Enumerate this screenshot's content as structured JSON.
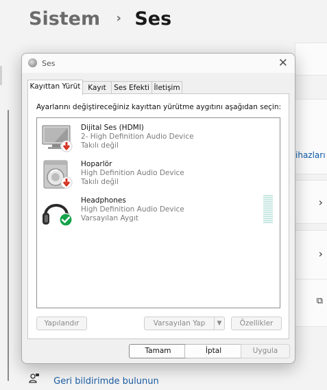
{
  "settings": {
    "breadcrumb_parent": "Sistem",
    "breadcrumb_sep": "›",
    "breadcrumb_current": "Ses",
    "link_partial": "ihazları",
    "chevron": "›",
    "external_icon": "⧉",
    "feedback_icon": "👤",
    "feedback_label": "Geri bildirimde bulunun"
  },
  "dialog": {
    "title": "Ses",
    "close_glyph": "✕",
    "tabs": [
      {
        "label": "Kayıttan Yürüt"
      },
      {
        "label": "Kayıt"
      },
      {
        "label": "Ses Efekti"
      },
      {
        "label": "İletişim"
      }
    ],
    "instruction": "Ayarlarını değiştireceğiniz kayıttan yürütme aygıtını aşağıdan seçin:",
    "devices": [
      {
        "name": "Dijital Ses (HDMI)",
        "driver": "2- High Definition Audio Device",
        "status": "Takılı değil",
        "icon": "monitor-icon",
        "badge": "red-down-arrow"
      },
      {
        "name": "Hoparlör",
        "driver": "High Definition Audio Device",
        "status": "Takılı değil",
        "icon": "speaker-icon",
        "badge": "red-down-arrow"
      },
      {
        "name": "Headphones",
        "driver": "High Definition Audio Device",
        "status": "Varsayılan Aygıt",
        "icon": "headphones-icon",
        "badge": "green-check"
      }
    ],
    "buttons": {
      "configure": "Yapılandır",
      "set_default": "Varsayılan Yap",
      "set_default_arrow": "▼",
      "properties": "Özellikler",
      "ok": "Tamam",
      "cancel": "İptal",
      "apply": "Uygula"
    }
  },
  "colors": {
    "link": "#0a59a8",
    "red_badge": "#d4301f",
    "green_badge": "#16a34a",
    "level_meter": "#c6e7e0"
  }
}
